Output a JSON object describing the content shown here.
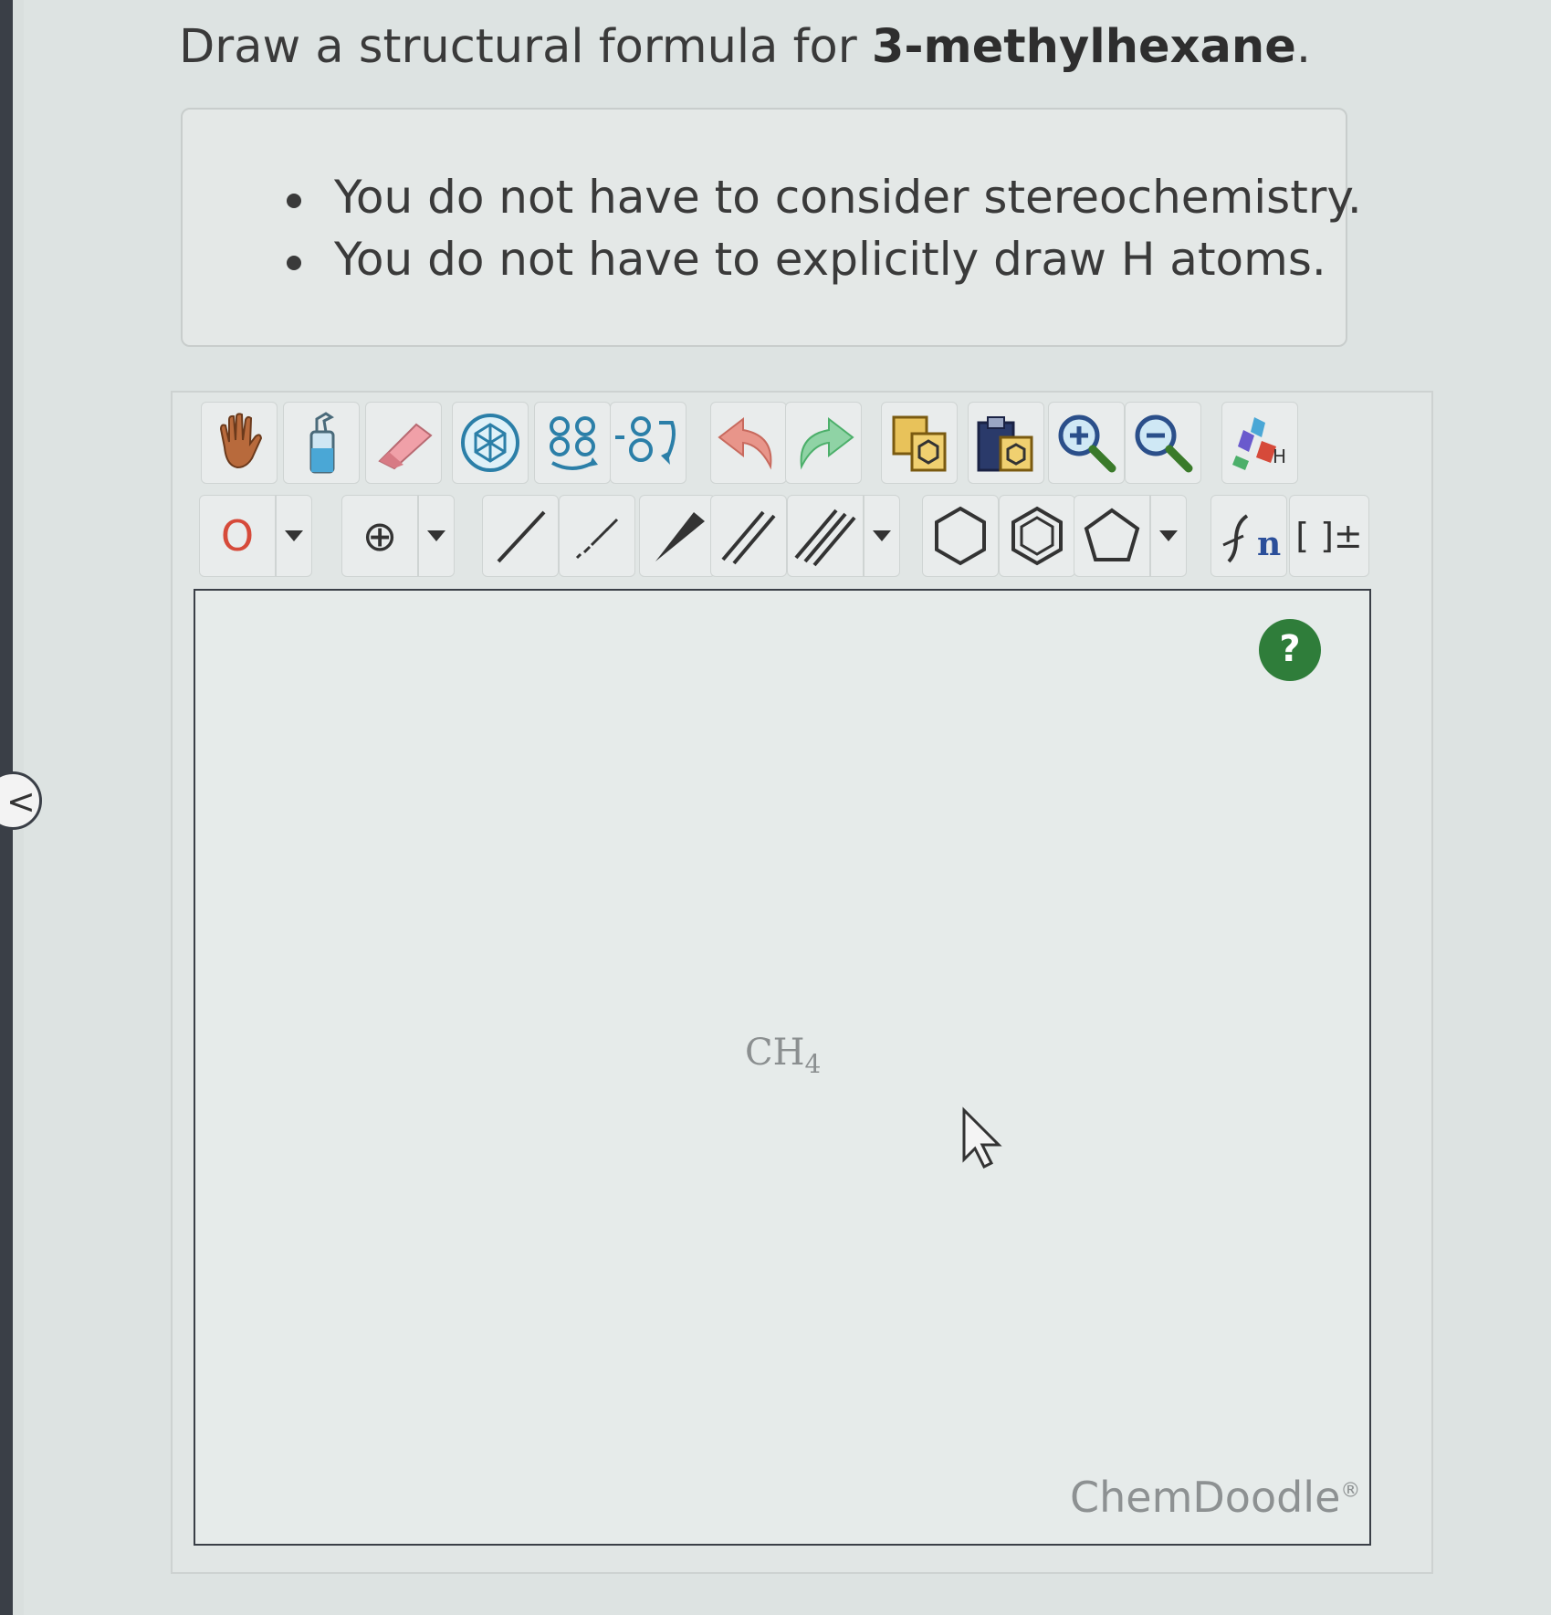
{
  "question": {
    "prefix": "Draw a structural formula for ",
    "compound": "3-methylhexane",
    "suffix": "."
  },
  "notes": [
    "You do not have to consider stereochemistry.",
    "You do not have to explicitly draw H atoms."
  ],
  "toolbar": {
    "row1": [
      "hand-icon",
      "bottle-icon",
      "eraser-icon",
      "ring-template-icon",
      "flip-icon",
      "rotate-icon",
      "undo-icon",
      "redo-icon",
      "copy-icon",
      "paste-icon",
      "zoom-in-icon",
      "zoom-out-icon",
      "clean-icon"
    ],
    "atom_label": "O",
    "charge_label": "⊕",
    "bracket_label": "[ ]±",
    "repeat_label": "n"
  },
  "canvas": {
    "help_label": "?",
    "molecule": {
      "main": "CH",
      "sub": "4"
    },
    "brand": "ChemDoodle",
    "brand_mark": "®"
  },
  "colors": {
    "atom": "#d64a3a",
    "help": "#2f7d3a",
    "ring": "#2b7fa8",
    "undo": "#e07a6a",
    "redo": "#4caf6a"
  }
}
